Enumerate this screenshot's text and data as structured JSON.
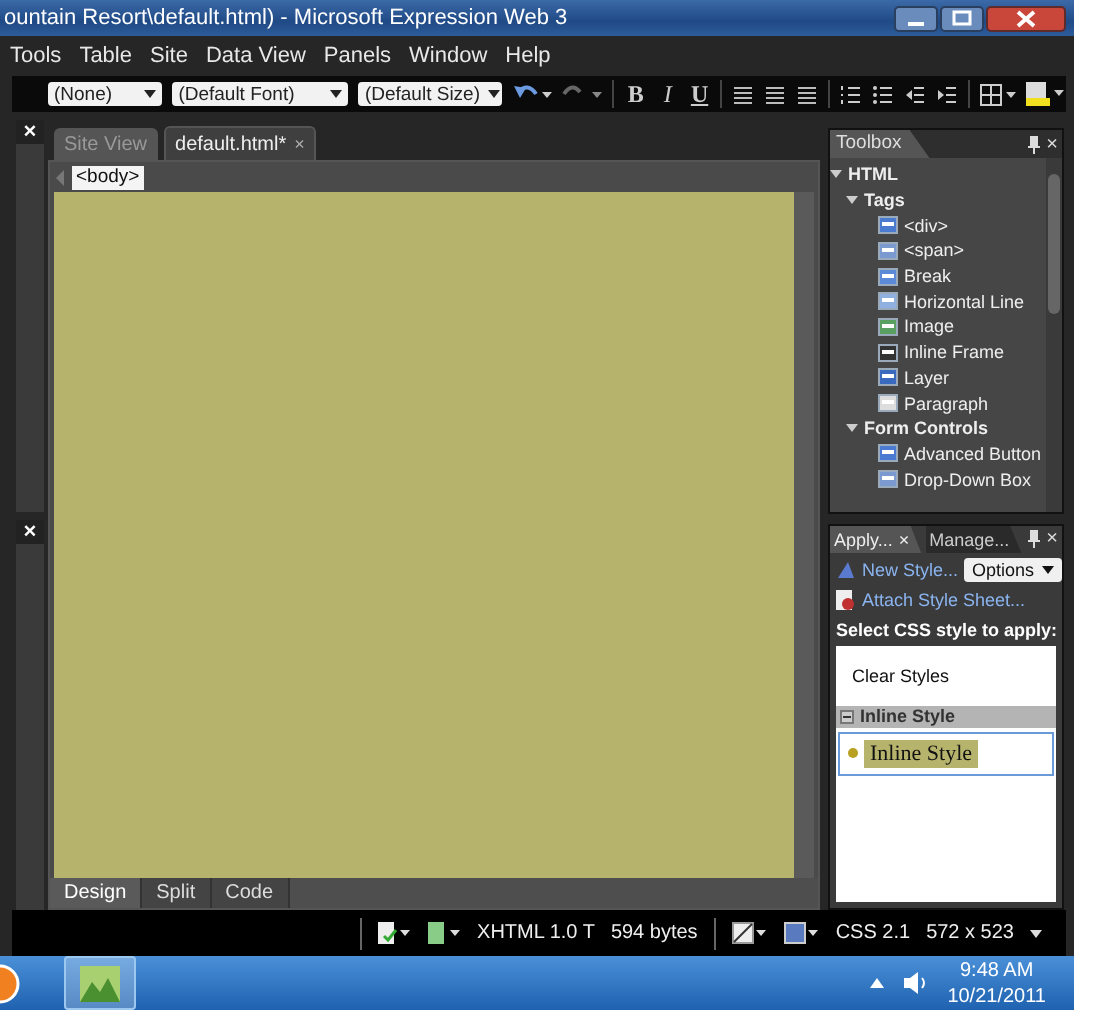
{
  "window": {
    "title": "ountain Resort\\default.html) - Microsoft Expression Web 3"
  },
  "menu": [
    "Tools",
    "Table",
    "Site",
    "Data View",
    "Panels",
    "Window",
    "Help"
  ],
  "toolbar": {
    "dropdowns": [
      "(None)",
      "(Default Font)",
      "(Default Size)"
    ],
    "format_buttons": [
      "B",
      "I",
      "U"
    ]
  },
  "left_panel": {
    "close": "×",
    "close_lower": "×"
  },
  "editor": {
    "tabs": [
      {
        "label": "Site View",
        "selected": false
      },
      {
        "label": "default.html*",
        "selected": true,
        "close": "×"
      }
    ],
    "breadcrumb": "<body>",
    "view_tabs": [
      {
        "label": "Design",
        "selected": true
      },
      {
        "label": "Split",
        "selected": false
      },
      {
        "label": "Code",
        "selected": false
      }
    ]
  },
  "toolbox": {
    "title": "Toolbox",
    "close": "×",
    "tree": [
      {
        "label": "HTML",
        "expanded": true,
        "children": [
          {
            "label": "Tags",
            "expanded": true,
            "children": [
              {
                "label": "<div>"
              },
              {
                "label": "<span>"
              },
              {
                "label": "Break"
              },
              {
                "label": "Horizontal Line"
              },
              {
                "label": "Image"
              },
              {
                "label": "Inline Frame"
              },
              {
                "label": "Layer"
              },
              {
                "label": "Paragraph"
              }
            ]
          },
          {
            "label": "Form Controls",
            "expanded": true,
            "children": [
              {
                "label": "Advanced Button"
              },
              {
                "label": "Drop-Down Box"
              }
            ]
          }
        ]
      }
    ]
  },
  "apply_styles": {
    "tabs": [
      {
        "label": "Apply...",
        "selected": true,
        "close": "×"
      },
      {
        "label": "Manage...",
        "selected": false
      }
    ],
    "close": "×",
    "new_style": "New Style...",
    "options": "Options",
    "attach": "Attach Style Sheet...",
    "prompt": "Select CSS style to apply:",
    "items": [
      {
        "kind": "plain",
        "label": "Clear Styles"
      },
      {
        "kind": "group",
        "label": "Inline Style",
        "expanded": true
      },
      {
        "kind": "style",
        "label": "Inline Style",
        "selected": true
      }
    ]
  },
  "status_bar": {
    "doctype": "XHTML 1.0 T",
    "size": "594 bytes",
    "css": "CSS 2.1",
    "page_size": "572 x 523"
  },
  "taskbar": {
    "time": "9:48 AM",
    "date": "10/21/2011"
  }
}
